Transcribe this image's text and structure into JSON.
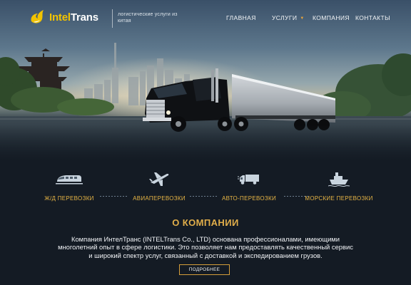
{
  "header": {
    "logo": {
      "part1": "Intel",
      "part2": "Trans"
    },
    "tagline": "логистические услуги из китая",
    "nav": {
      "home": "ГЛАВНАЯ",
      "services": "УСЛУГИ",
      "company": "КОМПАНИЯ",
      "contacts": "КОНТАКТЫ"
    }
  },
  "services": [
    {
      "label": "Ж/Д ПЕРЕВОЗКИ",
      "icon": "train-icon"
    },
    {
      "label": "АВИАПЕРЕВОЗКИ",
      "icon": "airplane-icon"
    },
    {
      "label": "АВТО-ПЕРЕВОЗКИ",
      "icon": "truck-icon"
    },
    {
      "label": "МОРСКИЕ ПЕРЕВОЗКИ",
      "icon": "ship-icon"
    }
  ],
  "about": {
    "title": "О КОМПАНИИ",
    "text": "Компания ИнтелТранс (INTELTrans Co., LTD) основана профессионалами, имеющими многолетний опыт в сфере логистики. Это позволяет нам предоставлять качественный сервис и широкий спектр услуг, связанный с доставкой и экспедированием грузов.",
    "button": "ПОДРОБНЕЕ"
  },
  "colors": {
    "accent": "#e1ae4a",
    "logo_yellow": "#f2c300",
    "background": "#141b24"
  }
}
